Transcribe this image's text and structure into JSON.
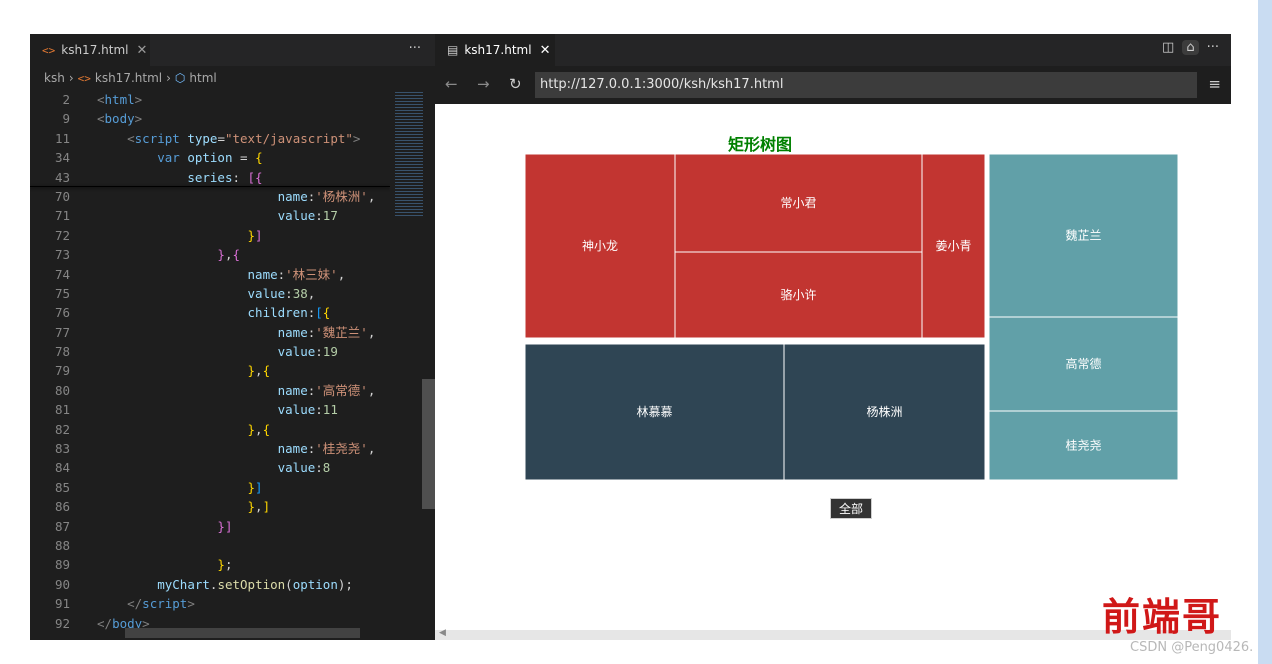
{
  "editor": {
    "tab_label": "ksh17.html",
    "tab_icon": "html-file-icon",
    "more_label": "···",
    "breadcrumb": {
      "folder": "ksh",
      "file": "ksh17.html",
      "element": "html"
    },
    "lines": [
      {
        "no": "2",
        "html": "<span class=\"t\">&lt;</span><span class=\"k\">html</span><span class=\"t\">&gt;</span>",
        "indent": 0
      },
      {
        "no": "9",
        "html": "<span class=\"t\">&lt;</span><span class=\"k\">body</span><span class=\"t\">&gt;</span>",
        "indent": 0
      },
      {
        "no": "11",
        "html": "    <span class=\"t\">&lt;</span><span class=\"k\">script</span> <span class=\"a\">type</span>=<span class=\"s\">\"text/javascript\"</span><span class=\"t\">&gt;</span>",
        "indent": 0
      },
      {
        "no": "34",
        "html": "        <span class=\"k\">var</span> <span class=\"a\">option</span> = <span class=\"b1\">{</span>",
        "indent": 0
      },
      {
        "no": "43",
        "html": "            <span class=\"a\">series</span>: <span class=\"b2\">[{</span>",
        "indent": 0
      },
      {
        "no": "70",
        "html": "                        <span class=\"a\">name</span>:<span class=\"s\">'杨株洲'</span>,",
        "indent": 0
      },
      {
        "no": "71",
        "html": "                        <span class=\"a\">value</span>:<span class=\"n\">17</span>",
        "indent": 0
      },
      {
        "no": "72",
        "html": "                    <span class=\"b1\">}</span><span class=\"b2\">]</span>",
        "indent": 0
      },
      {
        "no": "73",
        "html": "                <span class=\"b2\">}</span>,<span class=\"b2\">{</span>",
        "indent": 0
      },
      {
        "no": "74",
        "html": "                    <span class=\"a\">name</span>:<span class=\"s\">'林三妹'</span>,",
        "indent": 0
      },
      {
        "no": "75",
        "html": "                    <span class=\"a\">value</span>:<span class=\"n\">38</span>,",
        "indent": 0
      },
      {
        "no": "76",
        "html": "                    <span class=\"a\">children</span>:<span class=\"b3\">[</span><span class=\"b1\">{</span>",
        "indent": 0
      },
      {
        "no": "77",
        "html": "                        <span class=\"a\">name</span>:<span class=\"s\">'魏芷兰'</span>,",
        "indent": 0
      },
      {
        "no": "78",
        "html": "                        <span class=\"a\">value</span>:<span class=\"n\">19</span>",
        "indent": 0
      },
      {
        "no": "79",
        "html": "                    <span class=\"b1\">}</span>,<span class=\"b1\">{</span>",
        "indent": 0
      },
      {
        "no": "80",
        "html": "                        <span class=\"a\">name</span>:<span class=\"s\">'高常德'</span>,",
        "indent": 0
      },
      {
        "no": "81",
        "html": "                        <span class=\"a\">value</span>:<span class=\"n\">11</span>",
        "indent": 0
      },
      {
        "no": "82",
        "html": "                    <span class=\"b1\">}</span>,<span class=\"b1\">{</span>",
        "indent": 0
      },
      {
        "no": "83",
        "html": "                        <span class=\"a\">name</span>:<span class=\"s\">'桂尧尧'</span>,",
        "indent": 0
      },
      {
        "no": "84",
        "html": "                        <span class=\"a\">value</span>:<span class=\"n\">8</span>",
        "indent": 0
      },
      {
        "no": "85",
        "html": "                    <span class=\"b1\">}</span><span class=\"b3\">]</span>",
        "indent": 0
      },
      {
        "no": "86",
        "html": "                    <span class=\"b1\">}</span>,<span class=\"b1\">]</span>",
        "indent": 0
      },
      {
        "no": "87",
        "html": "                <span class=\"b2\">}]</span>",
        "indent": 0
      },
      {
        "no": "88",
        "html": "",
        "indent": 0
      },
      {
        "no": "89",
        "html": "                <span class=\"b1\">}</span>;",
        "indent": 0
      },
      {
        "no": "90",
        "html": "        <span class=\"a\">myChart</span>.<span class=\"f\">setOption</span>(<span class=\"a\">option</span>);",
        "indent": 0
      },
      {
        "no": "91",
        "html": "    <span class=\"t\">&lt;/</span><span class=\"k\">script</span><span class=\"t\">&gt;</span>",
        "indent": 0
      },
      {
        "no": "92",
        "html": "<span class=\"t\">&lt;/</span><span class=\"k\">body</span><span class=\"t\">&gt;</span>",
        "indent": 0
      }
    ]
  },
  "browser": {
    "tab_label": "ksh17.html",
    "url": "http://127.0.0.1:3000/ksh/ksh17.html",
    "back_icon": "←",
    "forward_icon": "→",
    "reload_icon": "↻",
    "menu_icon": "≡"
  },
  "chart_data": {
    "type": "treemap",
    "title": "矩形树图",
    "breadcrumb_label": "全部",
    "groups": [
      {
        "color": "#c23531",
        "children": [
          {
            "name": "神小龙"
          },
          {
            "name": "常小君"
          },
          {
            "name": "骆小许"
          },
          {
            "name": "姜小青"
          }
        ]
      },
      {
        "color": "#2f4554",
        "children": [
          {
            "name": "林慕慕"
          },
          {
            "name": "杨株洲",
            "value": 17
          }
        ]
      },
      {
        "name": "林三妹",
        "value": 38,
        "color": "#61a0a8",
        "children": [
          {
            "name": "魏芷兰",
            "value": 19
          },
          {
            "name": "高常德",
            "value": 11
          },
          {
            "name": "桂尧尧",
            "value": 8
          }
        ]
      }
    ]
  },
  "watermark": {
    "big": "前端哥",
    "small": "CSDN @Peng0426."
  }
}
